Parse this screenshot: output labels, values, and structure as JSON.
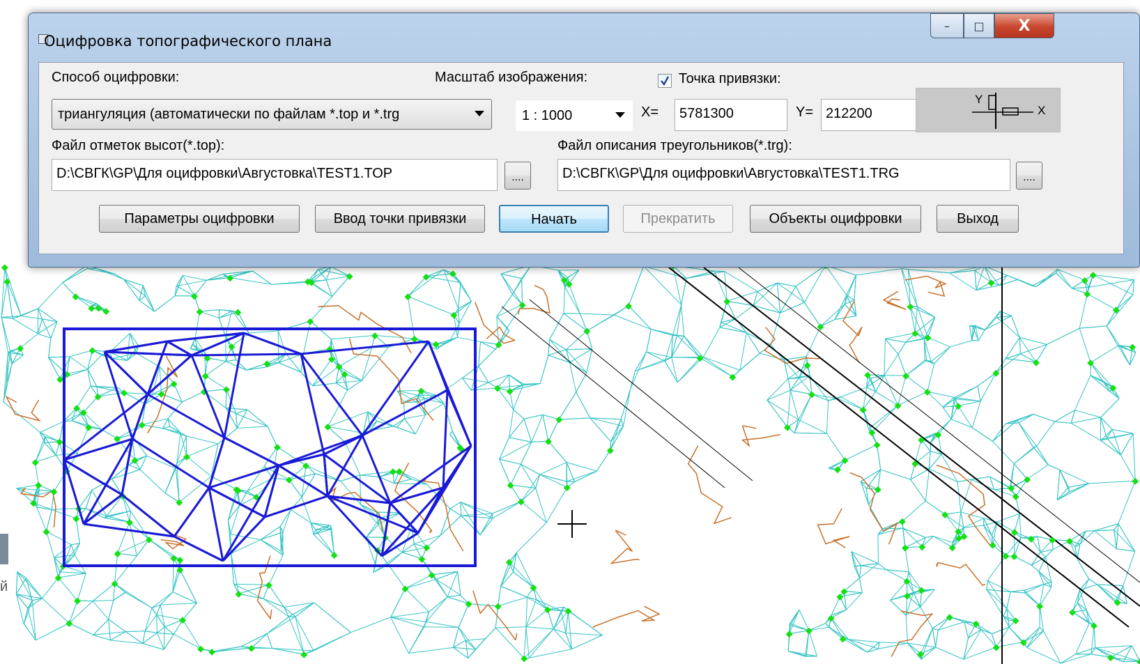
{
  "window": {
    "title": "Оцифровка топографического плана",
    "minimize_glyph": "–",
    "maximize_glyph": "□",
    "close_glyph": "X"
  },
  "form": {
    "method_label": "Способ оцифровки:",
    "method_value": "триангуляция (автоматически по файлам *.top и *.trg",
    "scale_label": "Масштаб  изображения:",
    "scale_value": "1 : 1000",
    "anchor_checkbox_label": "Точка привязки:",
    "anchor_checked": true,
    "x_label": "X=",
    "x_value": "5781300",
    "y_label": "Y=",
    "y_value": "212200",
    "axis_glyph_y": "Y",
    "axis_glyph_x": "X",
    "top_file_label": "Файл отметок высот(*.top):",
    "top_file_value": "D:\\СВГК\\GP\\Для оцифровки\\Августовка\\TEST1.TOP",
    "trg_file_label": "Файл описания треугольников(*.trg):",
    "trg_file_value": "D:\\СВГК\\GP\\Для оцифровки\\Августовка\\TEST1.TRG",
    "browse_label": "...."
  },
  "buttons": {
    "params": "Параметры оцифровки",
    "anchor_input": "Ввод точки привязки",
    "start": "Начать",
    "stop": "Прекратить",
    "objects": "Объекты оцифровки",
    "exit": "Выход"
  },
  "colors": {
    "triangulation": "#36c3c3",
    "contour": "#c8702a",
    "selection": "#1a1ad6",
    "markers": "#14e014",
    "linework": "#000000"
  },
  "map": {
    "sidebar_fragment": "й"
  }
}
